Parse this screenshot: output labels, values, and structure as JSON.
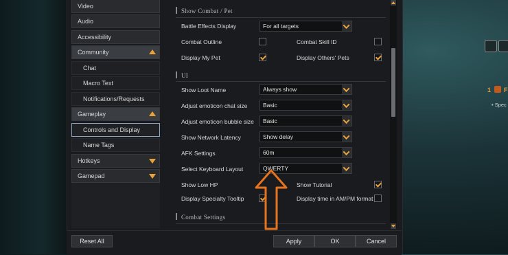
{
  "sidebar": {
    "items": [
      {
        "label": "Video",
        "type": "top"
      },
      {
        "label": "Audio",
        "type": "top"
      },
      {
        "label": "Accessibility",
        "type": "top"
      },
      {
        "label": "Community",
        "type": "group-open"
      },
      {
        "label": "Chat",
        "type": "sub"
      },
      {
        "label": "Macro Text",
        "type": "sub"
      },
      {
        "label": "Notifications/Requests",
        "type": "sub"
      },
      {
        "label": "Gameplay",
        "type": "group-open"
      },
      {
        "label": "Controls and Display",
        "type": "sub-selected"
      },
      {
        "label": "Name Tags",
        "type": "sub"
      },
      {
        "label": "Hotkeys",
        "type": "group-closed"
      },
      {
        "label": "Gamepad",
        "type": "group-closed"
      }
    ]
  },
  "sections": {
    "combat_pet": "Show Combat / Pet",
    "ui": "UI",
    "combat_settings": "Combat Settings"
  },
  "settings": {
    "battle_effects": {
      "label": "Battle Effects Display",
      "value": "For all targets"
    },
    "combat_outline": {
      "label": "Combat Outline",
      "checked": false
    },
    "combat_skill_id": {
      "label": "Combat Skill ID",
      "checked": false
    },
    "display_my_pet": {
      "label": "Display My Pet",
      "checked": true
    },
    "display_others_pets": {
      "label": "Display Others' Pets",
      "checked": true
    },
    "show_loot_name": {
      "label": "Show Loot Name",
      "value": "Always show"
    },
    "emoticon_chat_size": {
      "label": "Adjust emoticon chat size",
      "value": "Basic"
    },
    "emoticon_bubble_size": {
      "label": "Adjust emoticon bubble size",
      "value": "Basic"
    },
    "network_latency": {
      "label": "Show Network Latency",
      "value": "Show delay"
    },
    "afk_settings": {
      "label": "AFK Settings",
      "value": "60m"
    },
    "keyboard_layout": {
      "label": "Select Keyboard Layout",
      "value": "QWERTY"
    },
    "show_low_hp": {
      "label": "Show Low HP"
    },
    "show_tutorial": {
      "label": "Show Tutorial",
      "checked": true
    },
    "specialty_tooltip": {
      "label": "Display Specialty Tooltip",
      "checked": true
    },
    "ampm_format": {
      "label": "Display time in AM/PM format",
      "checked": false
    }
  },
  "footer": {
    "reset_all": "Reset All",
    "apply": "Apply",
    "ok": "OK",
    "cancel": "Cancel"
  },
  "hud": {
    "quest_count": "1",
    "quest_letter": "F",
    "side_text": "• Spec"
  },
  "colors": {
    "accent": "#e8a23a",
    "annotation_arrow": "#e8731e",
    "dialog_bg": "#1a1b1e"
  }
}
